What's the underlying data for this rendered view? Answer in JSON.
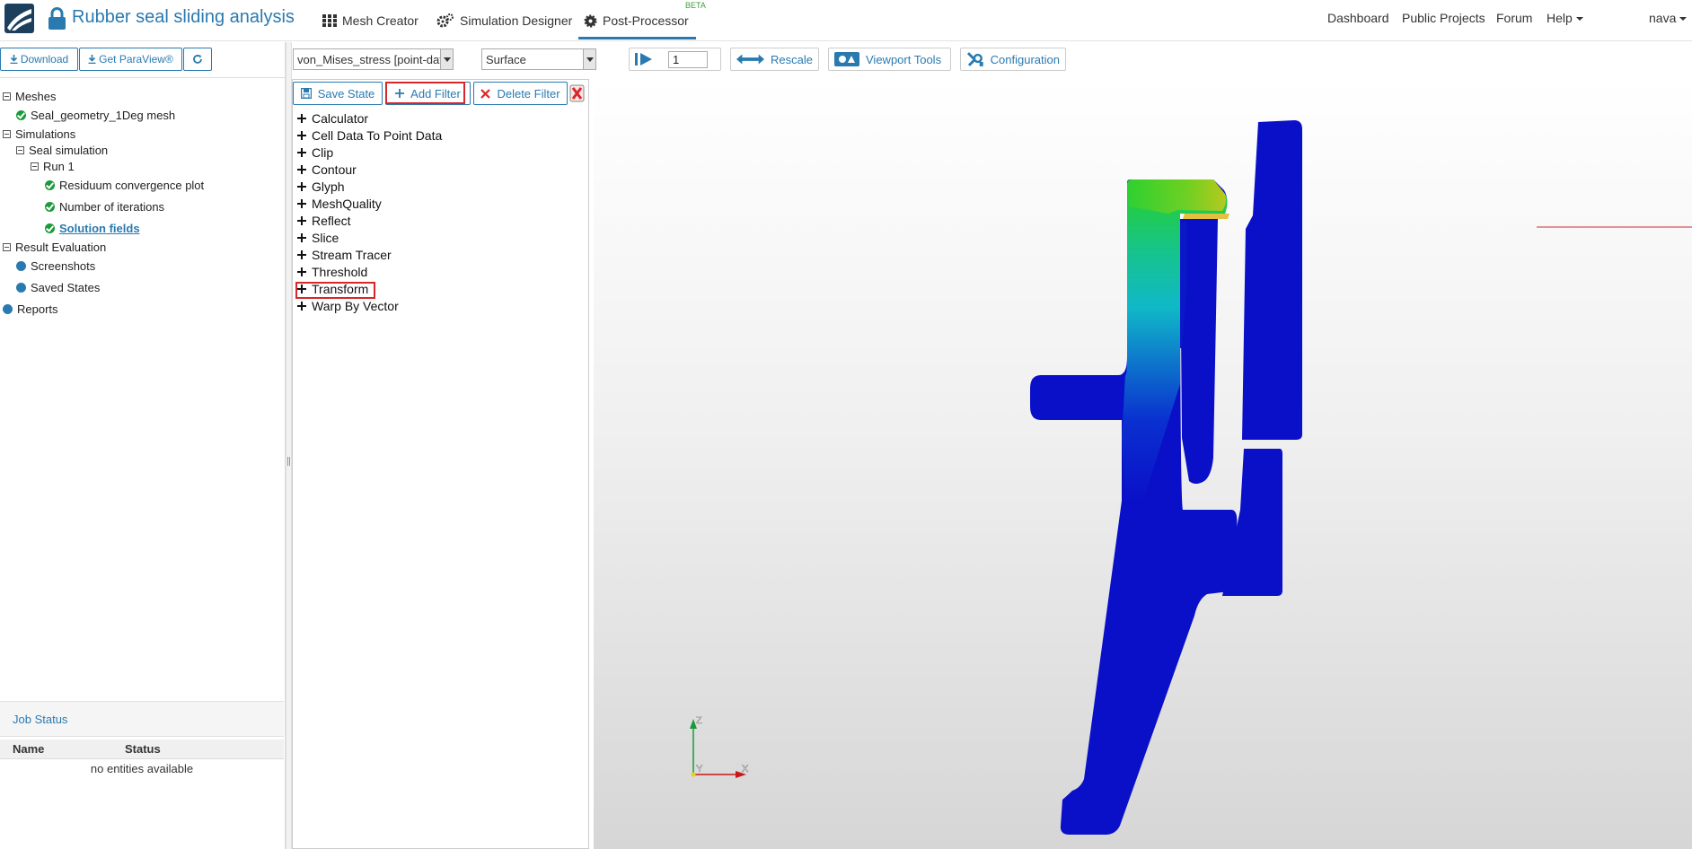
{
  "header": {
    "project_title": "Rubber seal sliding analysis",
    "tabs": [
      {
        "label": "Mesh Creator",
        "icon": "grid-icon"
      },
      {
        "label": "Simulation Designer",
        "icon": "gears-icon"
      },
      {
        "label": "Post-Processor",
        "icon": "cog-icon",
        "badge": "BETA",
        "active": true
      }
    ],
    "links": [
      "Dashboard",
      "Public Projects",
      "Forum",
      "Help"
    ],
    "user": "nava"
  },
  "sidebar": {
    "buttons": {
      "download": "Download",
      "get_paraview": "Get ParaView®"
    },
    "tree": {
      "meshes": "Meshes",
      "mesh_item": "Seal_geometry_1Deg mesh",
      "simulations": "Simulations",
      "seal_simulation": "Seal simulation",
      "run": "Run 1",
      "residuum": "Residuum convergence plot",
      "iterations": "Number of iterations",
      "solution_fields": "Solution fields",
      "result_evaluation": "Result Evaluation",
      "screenshots": "Screenshots",
      "saved_states": "Saved States",
      "reports": "Reports"
    },
    "job_status": {
      "title": "Job Status",
      "columns": [
        "Name",
        "Status"
      ],
      "empty": "no entities available"
    }
  },
  "toolbar": {
    "field_select": "von_Mises_stress [point-data]",
    "representation_select": "Surface",
    "frame_value": "1",
    "rescale": "Rescale",
    "viewport_tools": "Viewport Tools",
    "configuration": "Configuration"
  },
  "filters": {
    "save_state": "Save State",
    "add_filter": "Add Filter",
    "delete_filter": "Delete Filter",
    "items": [
      "Calculator",
      "Cell Data To Point Data",
      "Clip",
      "Contour",
      "Glyph",
      "MeshQuality",
      "Reflect",
      "Slice",
      "Stream Tracer",
      "Threshold",
      "Transform",
      "Warp By Vector"
    ],
    "highlighted": "Transform"
  },
  "viewport": {
    "axis_labels": {
      "z": "Z",
      "x": "X",
      "y": "Y"
    }
  },
  "colors": {
    "accent": "#2a7ab0",
    "success": "#1a9a3a",
    "highlight": "#d9262a",
    "stress_low": "#0a10c8",
    "stress_mid": "#10c0c0",
    "stress_high": "#2ad020"
  }
}
